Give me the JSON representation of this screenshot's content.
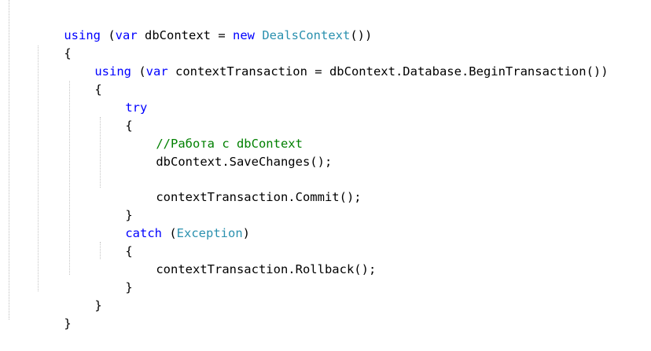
{
  "colors": {
    "keyword": "#0000ff",
    "type": "#2b91af",
    "comment": "#008000",
    "text": "#000000",
    "background": "#ffffff"
  },
  "code": {
    "l1": {
      "kw_using": "using",
      "p1": " (",
      "kw_var": "var",
      "p2": " dbContext = ",
      "kw_new": "new",
      "p3": " ",
      "type": "DealsContext",
      "p4": "())"
    },
    "l2": {
      "text": "{"
    },
    "l3": {
      "kw_using": "using",
      "p1": " (",
      "kw_var": "var",
      "p2": " contextTransaction = dbContext.Database.BeginTransaction())"
    },
    "l4": {
      "text": "{"
    },
    "l5": {
      "kw_try": "try"
    },
    "l6": {
      "text": "{"
    },
    "l7": {
      "comment": "//Работа с dbContext"
    },
    "l8": {
      "text": "dbContext.SaveChanges();"
    },
    "l10": {
      "text": "contextTransaction.Commit();"
    },
    "l11": {
      "text": "}"
    },
    "l12": {
      "kw_catch": "catch",
      "p1": " (",
      "type": "Exception",
      "p2": ")"
    },
    "l13": {
      "text": "{"
    },
    "l14": {
      "text": "contextTransaction.Rollback();"
    },
    "l15": {
      "text": "}"
    },
    "l16": {
      "text": "}"
    },
    "l17": {
      "text": "}"
    }
  }
}
